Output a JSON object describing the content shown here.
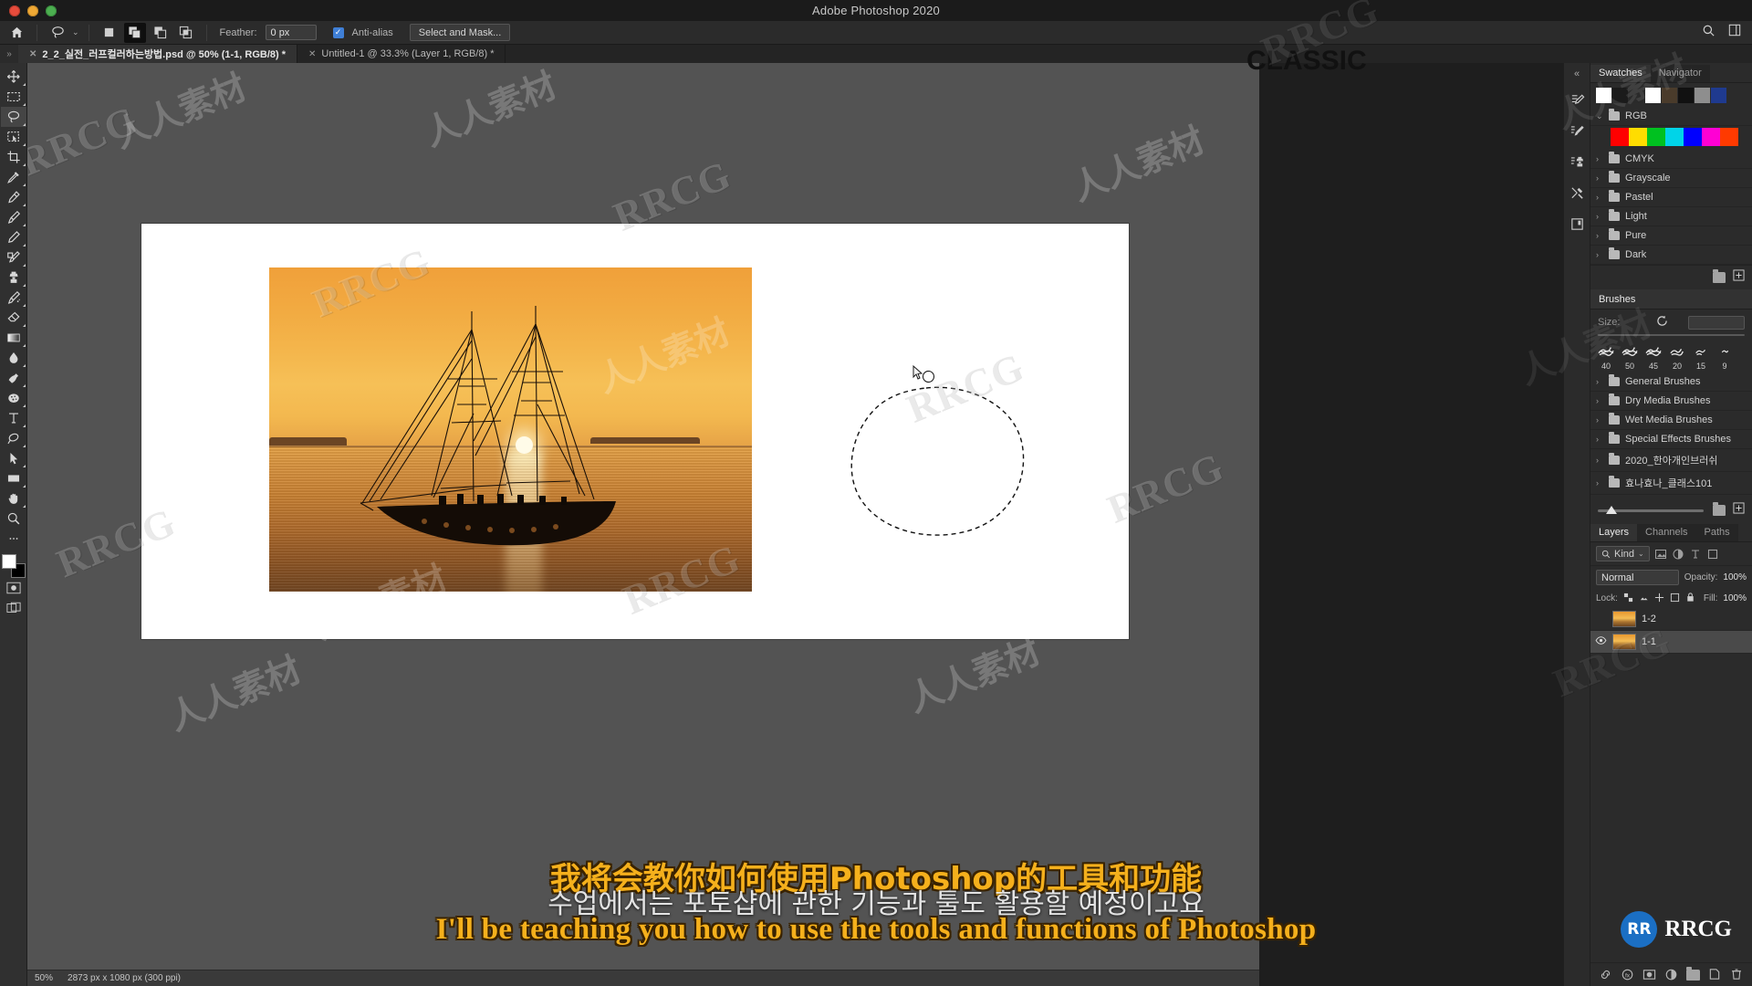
{
  "app": {
    "title": "Adobe Photoshop 2020"
  },
  "options_bar": {
    "home_icon": "home-icon",
    "tool_icon": "lasso-icon",
    "selection_modes": [
      "new-selection",
      "add-to-selection",
      "subtract-from-selection",
      "intersect-selection"
    ],
    "feather_label": "Feather:",
    "feather_value": "0 px",
    "antialias_label": "Anti-alias",
    "antialias_checked": true,
    "select_and_mask_label": "Select and Mask...",
    "right_icons": [
      "search-icon",
      "workspace-icon"
    ]
  },
  "tabs": [
    {
      "label": "2_2_실전_러프컬러하는방법.psd @ 50% (1-1, RGB/8) *",
      "active": true
    },
    {
      "label": "Untitled-1 @ 33.3% (Layer 1, RGB/8) *",
      "active": false
    }
  ],
  "toolbar": {
    "tools": [
      {
        "name": "move-tool",
        "icon": "move-icon"
      },
      {
        "name": "marquee-tool",
        "icon": "rectangular-marquee-icon"
      },
      {
        "name": "lasso-tool",
        "icon": "lasso-icon",
        "selected": true
      },
      {
        "name": "object-selection-tool",
        "icon": "quick-selection-icon"
      },
      {
        "name": "crop-tool",
        "icon": "crop-icon"
      },
      {
        "name": "eyedropper-tool",
        "icon": "eyedropper-icon"
      },
      {
        "name": "spot-healing-brush-tool",
        "icon": "healing-brush-icon"
      },
      {
        "name": "brush-tool",
        "icon": "brush-icon"
      },
      {
        "name": "pencil-tool",
        "icon": "pencil-icon"
      },
      {
        "name": "mixer-brush-tool",
        "icon": "mixer-brush-icon"
      },
      {
        "name": "clone-stamp-tool",
        "icon": "clone-stamp-icon"
      },
      {
        "name": "history-brush-tool",
        "icon": "history-brush-icon"
      },
      {
        "name": "eraser-tool",
        "icon": "eraser-icon"
      },
      {
        "name": "gradient-tool",
        "icon": "gradient-icon"
      },
      {
        "name": "blur-tool",
        "icon": "blur-drop-icon"
      },
      {
        "name": "dodge-tool",
        "icon": "dodge-hand-icon"
      },
      {
        "name": "sponge-tool",
        "icon": "sponge-icon"
      },
      {
        "name": "type-tool",
        "icon": "text-t-icon"
      },
      {
        "name": "pen-tool",
        "icon": "pen-icon"
      },
      {
        "name": "path-selection-tool",
        "icon": "path-arrow-icon"
      },
      {
        "name": "shape-tool",
        "icon": "rectangle-shape-icon"
      },
      {
        "name": "hand-tool",
        "icon": "hand-icon"
      },
      {
        "name": "zoom-tool",
        "icon": "magnifier-icon"
      },
      {
        "name": "more-tools",
        "icon": "ellipsis-icon"
      }
    ],
    "foreground_color": "#ffffff",
    "background_color": "#000000",
    "quick_mask": "quick-mask-icon",
    "screen_mode": "screen-mode-icon"
  },
  "document": {
    "zoom": "50%",
    "dimensions": "2873 px x 1080 px (300 ppi)",
    "image_alt": "sunset-sailboat-photo"
  },
  "panels": {
    "swatches": {
      "tabs": [
        {
          "label": "Swatches",
          "active": true
        },
        {
          "label": "Navigator",
          "active": false
        }
      ],
      "recent_colors": [
        "#ffffff",
        "#1b1b1b",
        "#2a2a2a",
        "#ffffff",
        "#4a3b2b",
        "#111111",
        "#8e8e8e",
        "#1f3a8f"
      ],
      "groups": [
        {
          "label": "RGB",
          "expanded": true,
          "colors": [
            "#ff0000",
            "#ffdd00",
            "#00c120",
            "#00d4e8",
            "#0000ff",
            "#ff00d4",
            "#ff3a00"
          ]
        },
        {
          "label": "CMYK",
          "expanded": false
        },
        {
          "label": "Grayscale",
          "expanded": false
        },
        {
          "label": "Pastel",
          "expanded": false
        },
        {
          "label": "Light",
          "expanded": false
        },
        {
          "label": "Pure",
          "expanded": false
        },
        {
          "label": "Dark",
          "expanded": false
        }
      ],
      "footer_icons": [
        "new-group-icon",
        "new-swatch-icon"
      ]
    },
    "brushes": {
      "tab_label": "Brushes",
      "size_label": "Size:",
      "size_value": "",
      "reset_icon": "reset-arrow-icon",
      "presets": [
        "40",
        "50",
        "45",
        "20",
        "15",
        "9"
      ],
      "groups": [
        "General Brushes",
        "Dry Media Brushes",
        "Wet Media Brushes",
        "Special Effects Brushes",
        "2020_한아개인브러쉬",
        "효나효나_클래스101"
      ],
      "footer_icons": [
        "new-group-icon",
        "new-brush-icon"
      ]
    },
    "layers": {
      "tabs": [
        {
          "label": "Layers",
          "active": true
        },
        {
          "label": "Channels",
          "active": false
        },
        {
          "label": "Paths",
          "active": false
        }
      ],
      "filter_label": "Kind",
      "filter_icons": [
        "search-icon",
        "pixel-layer-icon",
        "adjustment-layer-icon",
        "type-layer-icon",
        "shape-layer-icon",
        "smart-object-icon"
      ],
      "blend_mode": "Normal",
      "opacity_label": "Opacity:",
      "opacity_value": "100%",
      "lock_label": "Lock:",
      "lock_icons": [
        "lock-transparent-icon",
        "lock-image-icon",
        "lock-position-icon",
        "lock-artboard-icon",
        "lock-all-icon"
      ],
      "fill_label": "Fill:",
      "fill_value": "100%",
      "items": [
        {
          "name": "1-2",
          "visible": false,
          "selected": false,
          "thumb": "sunset"
        },
        {
          "name": "1-1",
          "visible": true,
          "selected": true,
          "thumb": "sunset"
        }
      ],
      "footer_icons": [
        "link-layers-icon",
        "layer-style-icon",
        "layer-mask-icon",
        "adjustment-layer-icon",
        "new-group-icon",
        "new-layer-icon",
        "delete-layer-icon"
      ]
    }
  },
  "workspace_label": "CLASSIC",
  "watermarks": {
    "brand_latin": "RRCG",
    "brand_cn": "人人素材",
    "badge_glyph": "RR",
    "badge_text": "RRCG"
  },
  "subtitles": {
    "chinese": "我将会教你如何使用Photoshop的工具和功能",
    "korean": "수업에서는 포토샵에 관한 기능과 툴도 활용할 예정이고요",
    "english": "I'll be teaching you how to use the tools and functions of Photoshop"
  }
}
